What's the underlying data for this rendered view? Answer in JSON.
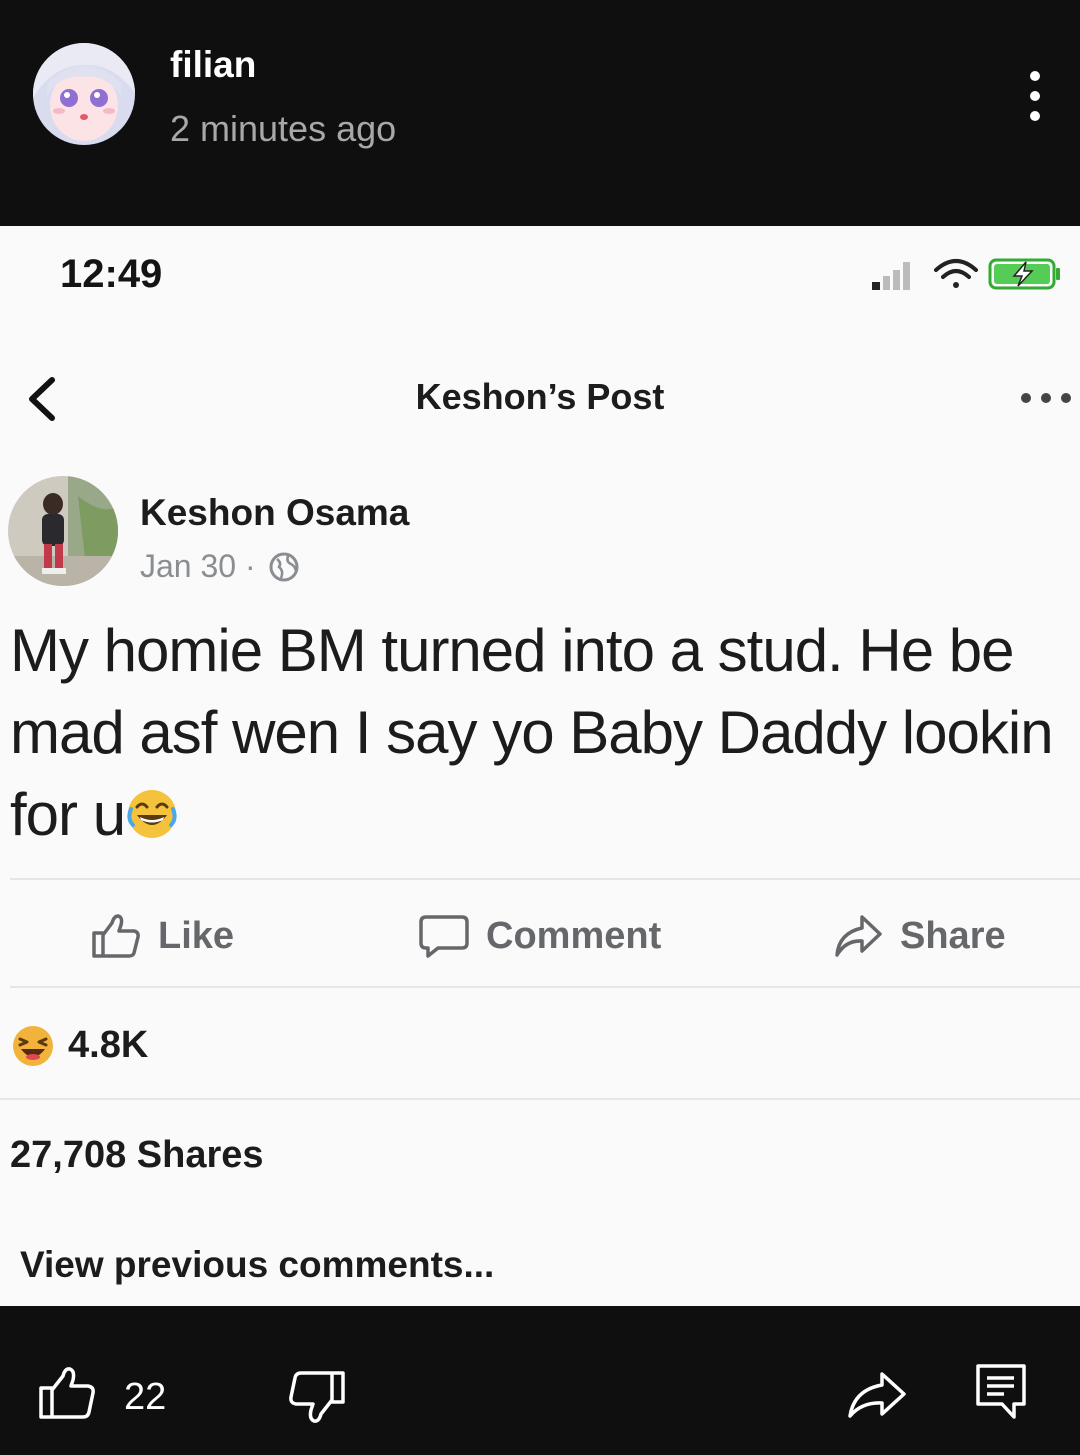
{
  "header": {
    "username": "filian",
    "timestamp": "2 minutes ago",
    "avatar_icon": "anime-avatar-icon",
    "menu_icon": "kebab-menu-icon"
  },
  "screenshot": {
    "status_bar": {
      "time": "12:49",
      "icons": [
        "signal-icon",
        "wifi-icon",
        "battery-charging-icon"
      ]
    },
    "nav": {
      "title": "Keshon’s Post",
      "back_icon": "chevron-left-icon",
      "more_icon": "more-horizontal-icon"
    },
    "post": {
      "author": "Keshon Osama",
      "date": "Jan 30 ·",
      "privacy_icon": "globe-icon",
      "text": "My homie BM turned into a stud. He be mad asf wen I say yo Baby Daddy lookin for u",
      "emoji_icon": "laughing-emoji-icon"
    },
    "actions": {
      "like": "Like",
      "comment": "Comment",
      "share": "Share"
    },
    "reactions": {
      "icon": "haha-reaction-icon",
      "count": "4.8K"
    },
    "shares_count": "27,708 Shares",
    "view_previous": "View previous comments..."
  },
  "bottom_bar": {
    "like_count": "22",
    "icons": [
      "thumbs-up-icon",
      "thumbs-down-icon",
      "share-arrow-icon",
      "comments-icon"
    ]
  },
  "colors": {
    "background": "#0f0f0f",
    "post_background": "#fafafa",
    "text_dark": "#1c1c1c",
    "action_gray": "#65676b",
    "meta_gray": "#8a8d91"
  }
}
